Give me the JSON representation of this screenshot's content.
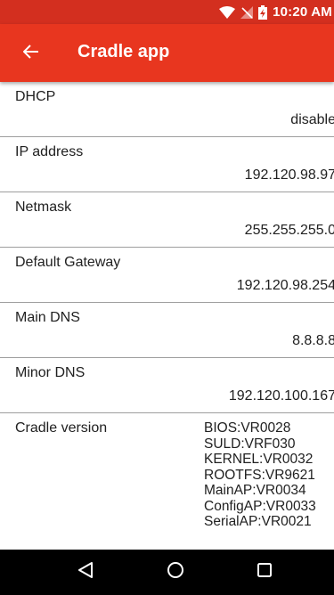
{
  "status_bar": {
    "time": "10:20 AM",
    "icons": [
      "wifi-icon",
      "signal-off-icon",
      "battery-charging-icon"
    ],
    "color": "#d32f1f"
  },
  "app_bar": {
    "title": "Cradle app",
    "back_icon": "arrow-left-icon",
    "color": "#e8361f"
  },
  "settings": [
    {
      "label": "DHCP",
      "value": "disable"
    },
    {
      "label": "IP address",
      "value": "192.120.98.97"
    },
    {
      "label": "Netmask",
      "value": "255.255.255.0"
    },
    {
      "label": "Default Gateway",
      "value": "192.120.98.254"
    },
    {
      "label": "Main DNS",
      "value": "8.8.8.8"
    },
    {
      "label": "Minor DNS",
      "value": "192.120.100.167"
    }
  ],
  "cradle_version": {
    "label": "Cradle version",
    "items": [
      "BIOS:VR0028",
      "SULD:VRF030",
      "KERNEL:VR0032",
      "ROOTFS:VR9621",
      "MainAP:VR0034",
      "ConfigAP:VR0033",
      "SerialAP:VR0021"
    ]
  },
  "nav_bar": {
    "icons": [
      "back-triangle-icon",
      "home-circle-icon",
      "recents-square-icon"
    ]
  }
}
